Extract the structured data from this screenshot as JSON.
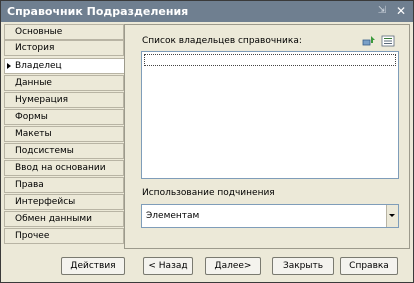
{
  "window": {
    "title": "Справочник Подразделения"
  },
  "nav": {
    "items": [
      {
        "label": "Основные"
      },
      {
        "label": "История"
      },
      {
        "label": "Владелец",
        "active": true
      },
      {
        "label": "Данные"
      },
      {
        "label": "Нумерация"
      },
      {
        "label": "Формы"
      },
      {
        "label": "Макеты"
      },
      {
        "label": "Подсистемы"
      },
      {
        "label": "Ввод на основании"
      },
      {
        "label": "Права"
      },
      {
        "label": "Интерфейсы"
      },
      {
        "label": "Обмен данными"
      },
      {
        "label": "Прочее"
      }
    ]
  },
  "panel": {
    "list_label": "Список владельцев справочника:",
    "usage_label": "Использование подчинения",
    "usage_value": "Элементам"
  },
  "buttons": {
    "actions": "Действия",
    "back": "< Назад",
    "next": "Далее>",
    "close": "Закрыть",
    "help": "Справка"
  },
  "colors": {
    "titlebar": "#6f7f90",
    "window_bg": "#ece9d8"
  }
}
